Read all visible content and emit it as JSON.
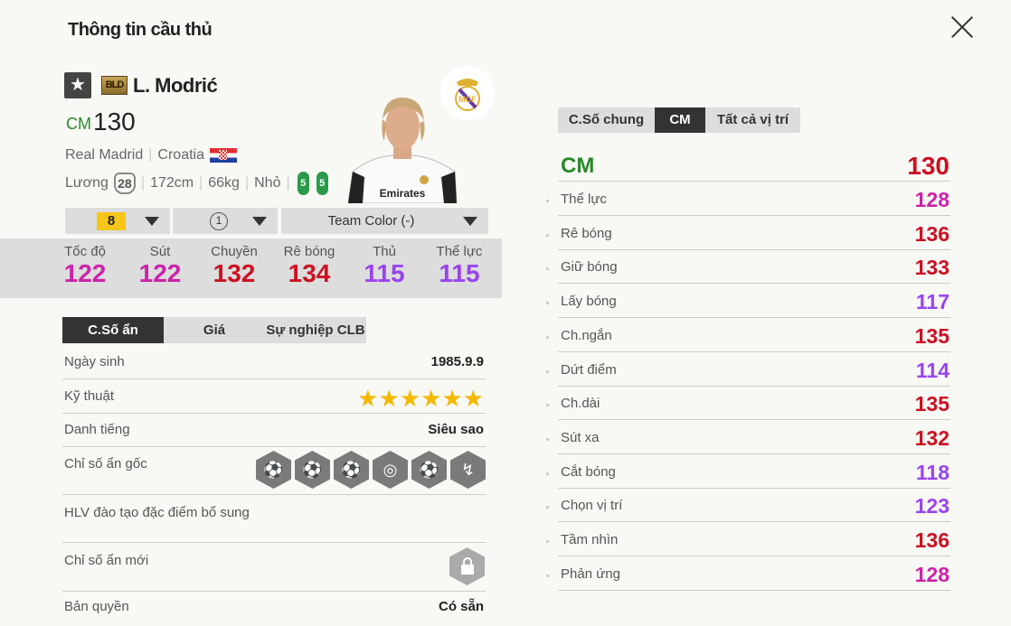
{
  "header": {
    "title": "Thông tin cầu thủ"
  },
  "player": {
    "season_badge": "BLD",
    "name": "L. Modrić",
    "position": "CM",
    "ovr": "130",
    "club": "Real Madrid",
    "nation": "Croatia",
    "salary_label": "Lương",
    "salary": "28",
    "height": "172cm",
    "weight": "66kg",
    "body": "Nhỏ",
    "left_foot": "5",
    "right_foot": "5"
  },
  "dropdowns": {
    "level": "8",
    "team_rank": "1",
    "team_color": "Team Color (-)"
  },
  "summary_stats": [
    {
      "label": "Tốc độ",
      "value": "122",
      "color": "#cc22aa"
    },
    {
      "label": "Sút",
      "value": "122",
      "color": "#cc22aa"
    },
    {
      "label": "Chuyền",
      "value": "132",
      "color": "#cc1122"
    },
    {
      "label": "Rê bóng",
      "value": "134",
      "color": "#cc1122"
    },
    {
      "label": "Thủ",
      "value": "115",
      "color": "#9944ee"
    },
    {
      "label": "Thể lực",
      "value": "115",
      "color": "#9944ee"
    }
  ],
  "left_tabs": [
    "C.Số ẩn",
    "Giá",
    "Sự nghiệp CLB"
  ],
  "details": {
    "birth_label": "Ngày sinh",
    "birth": "1985.9.9",
    "skill_label": "Kỹ thuật",
    "skill_stars": "★★★★★★",
    "fame_label": "Danh tiếng",
    "fame": "Siêu sao",
    "traits_label": "Chỉ số ẩn gốc",
    "coach_label": "HLV đào tạo đặc điểm bổ sung",
    "new_traits_label": "Chỉ số ẩn mới",
    "license_label": "Bản quyền",
    "license": "Có sẵn"
  },
  "right_tabs": [
    "C.Số chung",
    "CM",
    "Tất cả vị trí"
  ],
  "position_header": {
    "label": "CM",
    "value": "130"
  },
  "attributes": [
    {
      "label": "Thể lực",
      "value": "128",
      "color": "#cc22aa"
    },
    {
      "label": "Rê bóng",
      "value": "136",
      "color": "#cc1122"
    },
    {
      "label": "Giữ bóng",
      "value": "133",
      "color": "#cc1122"
    },
    {
      "label": "Lấy bóng",
      "value": "117",
      "color": "#9944ee"
    },
    {
      "label": "Ch.ngắn",
      "value": "135",
      "color": "#cc1122"
    },
    {
      "label": "Dứt điểm",
      "value": "114",
      "color": "#9944ee"
    },
    {
      "label": "Ch.dài",
      "value": "135",
      "color": "#cc1122"
    },
    {
      "label": "Sút xa",
      "value": "132",
      "color": "#cc1122"
    },
    {
      "label": "Cắt bóng",
      "value": "118",
      "color": "#9944ee"
    },
    {
      "label": "Chọn vị trí",
      "value": "123",
      "color": "#9944ee"
    },
    {
      "label": "Tầm nhìn",
      "value": "136",
      "color": "#cc1122"
    },
    {
      "label": "Phản ứng",
      "value": "128",
      "color": "#cc22aa"
    }
  ]
}
